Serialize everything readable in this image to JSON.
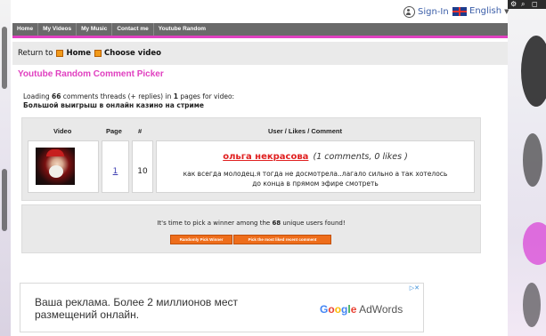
{
  "topbar": {
    "signin": "Sign-In",
    "language": "English"
  },
  "nav": [
    "Home",
    "My Videos",
    "My Music",
    "Contact me",
    "Youtube Random"
  ],
  "breadcrumb": {
    "prefix": "Return to",
    "home": "Home",
    "choose": "Choose video"
  },
  "page_title": "Youtube Random Comment Picker",
  "loading": {
    "text_before": "Loading ",
    "count": "66",
    "text_mid": " comments threads (+ replies) in ",
    "pages": "1",
    "text_after": " pages for video:",
    "video_title": "Большой выигрыш в онлайн казино на стриме"
  },
  "table": {
    "headers": {
      "video": "Video",
      "page": "Page",
      "num": "#",
      "user": "User / Likes / Comment"
    },
    "row": {
      "page": "1",
      "num": "10",
      "user": "ольга некрасова",
      "meta": "(1 comments, 0 likes )",
      "comment": "как всегда молодец.я тогда не досмотрела..лагало сильно а так хотелось до конца в прямом эфире смотреть"
    }
  },
  "winner": {
    "text_before": "It's time to pick a winner among the ",
    "count": "68",
    "text_after": " unique users found!",
    "random_button": "Randomly Pick Winner",
    "liked_button": "Pick the most liked recent comment"
  },
  "ad": {
    "text": "Ваша реклама. Более 2 миллионов мест размещений онлайн.",
    "brand": "AdWords",
    "choice": "▷✕"
  },
  "colors": {
    "accent": "#e040c0",
    "nav": "#6a6a6a",
    "button": "#ee6d1b",
    "user_link": "#e02020"
  }
}
